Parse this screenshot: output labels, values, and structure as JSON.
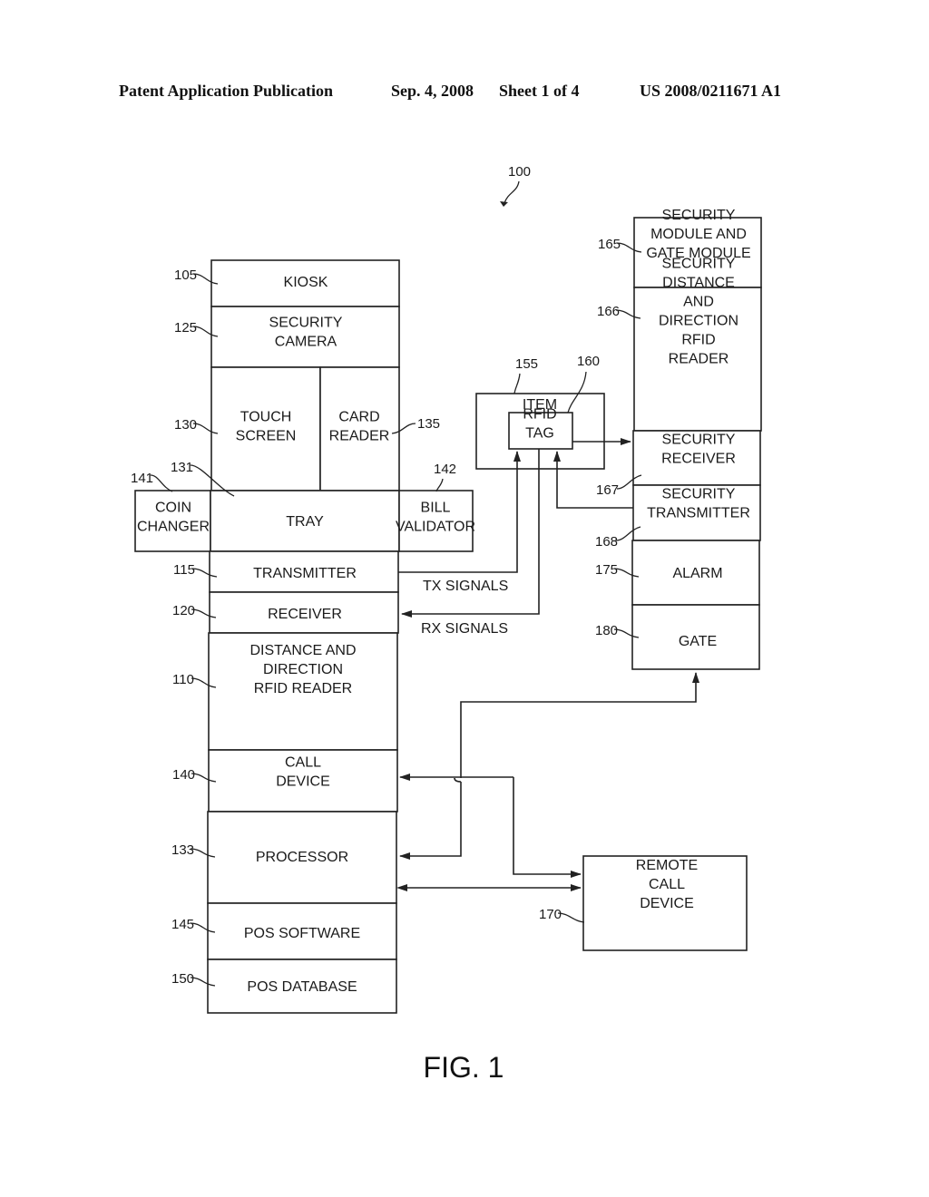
{
  "header": {
    "publication": "Patent Application Publication",
    "date": "Sep. 4, 2008",
    "sheet": "Sheet 1 of 4",
    "number": "US 2008/0211671 A1"
  },
  "figure": {
    "system_ref": "100",
    "caption": "FIG. 1"
  },
  "kiosk_stack": {
    "kiosk": {
      "ref": "105",
      "lines": [
        "KIOSK"
      ]
    },
    "security_camera": {
      "ref": "125",
      "lines": [
        "SECURITY",
        "CAMERA"
      ]
    },
    "touch_screen": {
      "ref": "130",
      "lines": [
        "TOUCH",
        "SCREEN"
      ]
    },
    "card_reader": {
      "ref": "135",
      "lines": [
        "CARD",
        "READER"
      ]
    },
    "tray": {
      "ref": "131",
      "lines": [
        "TRAY"
      ]
    },
    "coin_changer": {
      "ref": "141",
      "lines": [
        "COIN",
        "CHANGER"
      ]
    },
    "bill_validator": {
      "ref": "142",
      "lines": [
        "BILL",
        "VALIDATOR"
      ]
    },
    "transmitter": {
      "ref": "115",
      "lines": [
        "TRANSMITTER"
      ]
    },
    "receiver": {
      "ref": "120",
      "lines": [
        "RECEIVER"
      ]
    },
    "rfid_reader": {
      "ref": "110",
      "lines": [
        "DISTANCE AND",
        "DIRECTION",
        "RFID READER"
      ]
    },
    "call_device": {
      "ref": "140",
      "lines": [
        "CALL",
        "DEVICE"
      ]
    },
    "processor": {
      "ref": "133",
      "lines": [
        "PROCESSOR"
      ]
    },
    "pos_software": {
      "ref": "145",
      "lines": [
        "POS SOFTWARE"
      ]
    },
    "pos_database": {
      "ref": "150",
      "lines": [
        "POS DATABASE"
      ]
    }
  },
  "item": {
    "item": {
      "ref": "155",
      "lines": [
        "ITEM"
      ]
    },
    "rfid_tag": {
      "ref": "160",
      "lines": [
        "RFID",
        "TAG"
      ]
    }
  },
  "security_stack": {
    "security_module": {
      "ref": "165",
      "lines": [
        "SECURITY",
        "MODULE AND",
        "GATE MODULE"
      ]
    },
    "security_reader": {
      "ref": "166",
      "lines": [
        "SECURITY",
        "DISTANCE",
        "AND",
        "DIRECTION",
        "RFID",
        "READER"
      ]
    },
    "security_receiver": {
      "ref": "167",
      "lines": [
        "SECURITY",
        "RECEIVER"
      ]
    },
    "security_transmitter": {
      "ref": "168",
      "lines": [
        "SECURITY",
        "TRANSMITTER"
      ]
    },
    "alarm": {
      "ref": "175",
      "lines": [
        "ALARM"
      ]
    },
    "gate": {
      "ref": "180",
      "lines": [
        "GATE"
      ]
    }
  },
  "remote": {
    "remote_call_device": {
      "ref": "170",
      "lines": [
        "REMOTE",
        "CALL",
        "DEVICE"
      ]
    }
  },
  "signals": {
    "tx": "TX SIGNALS",
    "rx": "RX SIGNALS"
  }
}
